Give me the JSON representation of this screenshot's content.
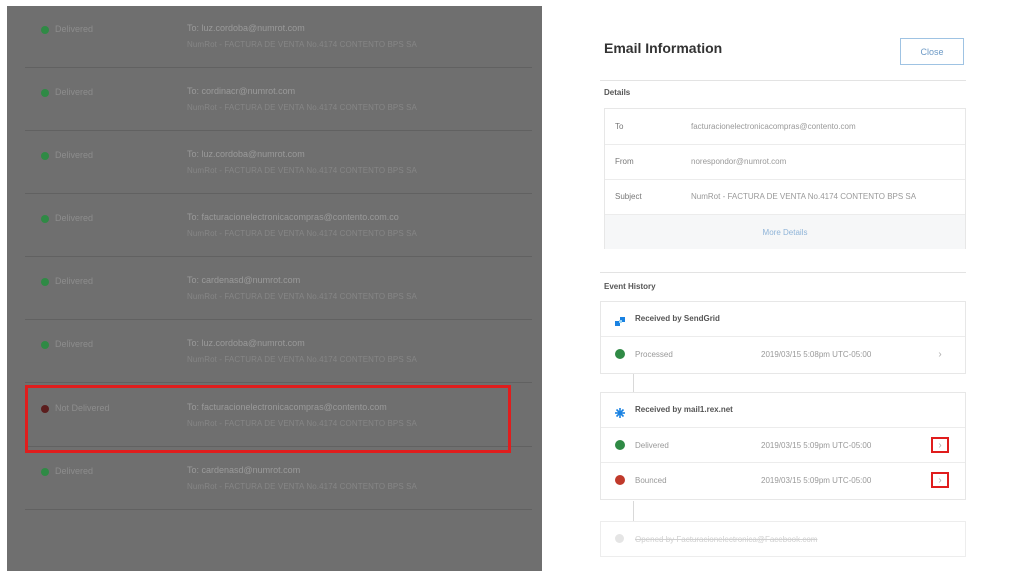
{
  "email_list": {
    "rows": [
      {
        "status": "Delivered",
        "to": "To: luz.cordoba@numrot.com",
        "subject": "NumRot - FACTURA DE VENTA No.4174 CONTENTO BPS SA"
      },
      {
        "status": "Delivered",
        "to": "To: cordinacr@numrot.com",
        "subject": "NumRot - FACTURA DE VENTA No.4174 CONTENTO BPS SA"
      },
      {
        "status": "Delivered",
        "to": "To: luz.cordoba@numrot.com",
        "subject": "NumRot - FACTURA DE VENTA No.4174 CONTENTO BPS SA"
      },
      {
        "status": "Delivered",
        "to": "To: facturacionelectronicacompras@contento.com.co",
        "subject": "NumRot - FACTURA DE VENTA No.4174 CONTENTO BPS SA"
      },
      {
        "status": "Delivered",
        "to": "To: cardenasd@numrot.com",
        "subject": "NumRot - FACTURA DE VENTA No.4174 CONTENTO BPS SA"
      },
      {
        "status": "Delivered",
        "to": "To: luz.cordoba@numrot.com",
        "subject": "NumRot - FACTURA DE VENTA No.4174 CONTENTO BPS SA"
      },
      {
        "status": "Not Delivered",
        "to": "To: facturacionelectronicacompras@contento.com",
        "subject": "NumRot - FACTURA DE VENTA No.4174 CONTENTO BPS SA"
      },
      {
        "status": "Delivered",
        "to": "To: cardenasd@numrot.com",
        "subject": "NumRot - FACTURA DE VENTA No.4174 CONTENTO BPS SA"
      }
    ]
  },
  "panel": {
    "title": "Email Information",
    "close_label": "Close",
    "details_label": "Details",
    "details": {
      "to_key": "To",
      "to_value": "facturacionelectronicacompras@contento.com",
      "from_key": "From",
      "from_value": "norespondor@numrot.com",
      "subject_key": "Subject",
      "subject_value": "NumRot - FACTURA DE VENTA No.4174 CONTENTO BPS SA",
      "more_details": "More Details"
    },
    "event_history_label": "Event History",
    "sendgrid": {
      "header": "Received by SendGrid",
      "events": [
        {
          "label": "Processed",
          "time": "2019/03/15 5:08pm UTC-05:00"
        }
      ]
    },
    "mx": {
      "header": "Received by mail1.rex.net",
      "events": [
        {
          "label": "Delivered",
          "time": "2019/03/15 5:09pm UTC-05:00"
        },
        {
          "label": "Bounced",
          "time": "2019/03/15 5:09pm UTC-05:00"
        }
      ]
    },
    "last_event": "Opened by Facturacionelectronica@Facebook.com"
  },
  "colors": {
    "delivered": "#2f8a45",
    "bounced": "#c0392b",
    "highlight": "#e01d1d",
    "link": "#8fb4d8"
  }
}
